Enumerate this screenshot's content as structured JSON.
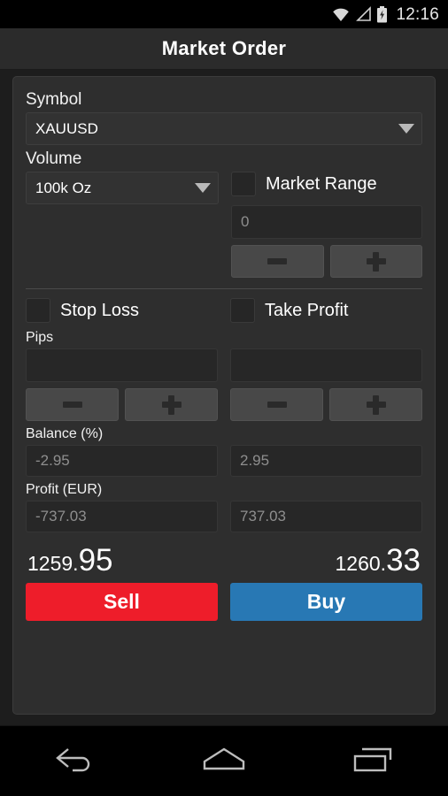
{
  "statusbar": {
    "time": "12:16",
    "icons": [
      "wifi-icon",
      "signal-icon",
      "battery-charging-icon"
    ]
  },
  "header": {
    "title": "Market Order"
  },
  "form": {
    "symbol": {
      "label": "Symbol",
      "value": "XAUUSD"
    },
    "volume": {
      "label": "Volume",
      "value": "100k Oz"
    },
    "market_range": {
      "label": "Market Range",
      "checked": false,
      "value": "0",
      "minus_label": "−",
      "plus_label": "+"
    },
    "stop_loss": {
      "label": "Stop Loss",
      "checked": false,
      "value": ""
    },
    "take_profit": {
      "label": "Take Profit",
      "checked": false,
      "value": ""
    },
    "pips_label": "Pips",
    "balance": {
      "label": "Balance (%)",
      "sell_value": "-2.95",
      "buy_value": "2.95"
    },
    "profit": {
      "label": "Profit (EUR)",
      "sell_value": "-737.03",
      "buy_value": "737.03"
    }
  },
  "quotes": {
    "bid": {
      "integer": "1259.",
      "decimal": "95"
    },
    "ask": {
      "integer": "1260.",
      "decimal": "33"
    }
  },
  "actions": {
    "sell_label": "Sell",
    "buy_label": "Buy",
    "sell_color": "#ee1d2a",
    "buy_color": "#2878b4"
  },
  "navbar": {
    "back": "back-icon",
    "home": "home-icon",
    "recents": "recents-icon"
  },
  "theme": {
    "page_bg": "#1d1d1d",
    "card_bg": "#2e2e2e",
    "field_bg": "#272727",
    "button_bg": "#484848",
    "text": "#ffffff"
  }
}
